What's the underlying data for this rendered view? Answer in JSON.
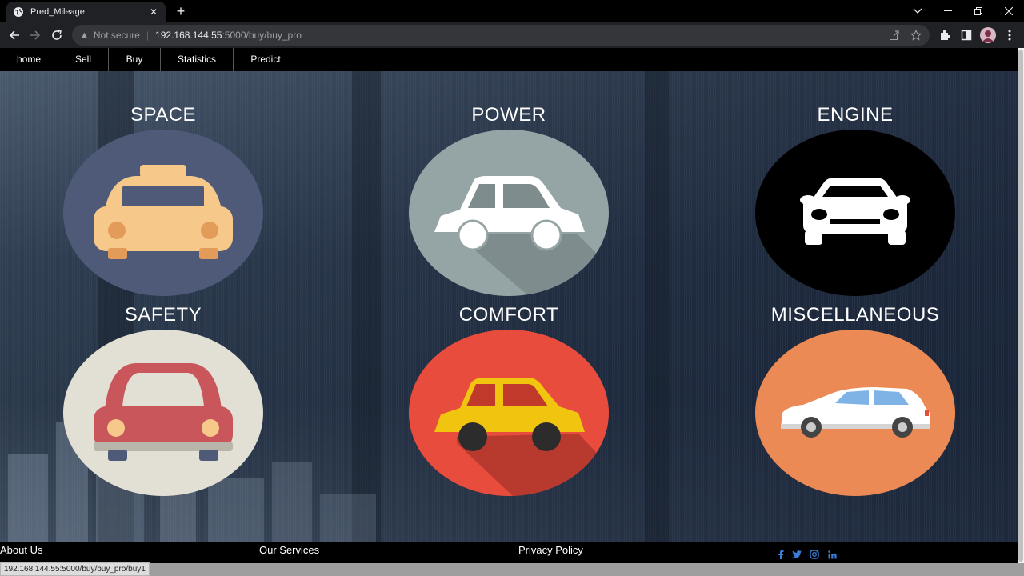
{
  "browser": {
    "tab_title": "Pred_Mileage",
    "new_tab_symbol": "+",
    "address_warning": "Not secure",
    "url_host": "192.168.144.55",
    "url_path": ":5000/buy/buy_pro",
    "status_url": "192.168.144.55:5000/buy/buy_pro/buy1"
  },
  "nav": {
    "items": [
      {
        "label": "home"
      },
      {
        "label": "Sell"
      },
      {
        "label": "Buy"
      },
      {
        "label": "Statistics"
      },
      {
        "label": "Predict"
      }
    ]
  },
  "categories": [
    {
      "label": "SPACE",
      "icon": "taxi-icon",
      "color": "#4e5a78"
    },
    {
      "label": "POWER",
      "icon": "car-side-icon",
      "color": "#95a5a6"
    },
    {
      "label": "ENGINE",
      "icon": "car-front-icon",
      "color": "#000000"
    },
    {
      "label": "SAFETY",
      "icon": "car-front-red-icon",
      "color": "#e2e0d4"
    },
    {
      "label": "COMFORT",
      "icon": "yellow-car-icon",
      "color": "#e74c3c"
    },
    {
      "label": "MISCELLANEOUS",
      "icon": "hatchback-icon",
      "color": "#ec8a55"
    }
  ],
  "footer": {
    "about": "About Us",
    "services": "Our Services",
    "privacy": "Privacy Policy",
    "social": [
      "facebook-icon",
      "twitter-icon",
      "instagram-icon",
      "linkedin-icon"
    ],
    "social_color": "#3b7dd8"
  }
}
